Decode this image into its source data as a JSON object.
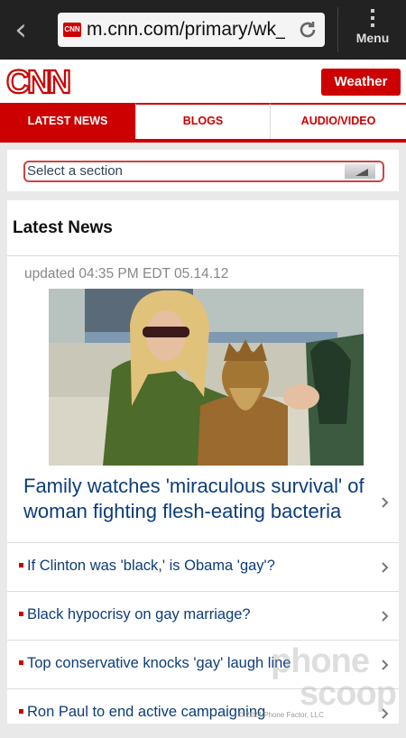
{
  "browser": {
    "url": "m.cnn.com/primary/wk_...",
    "favicon_text": "CNN",
    "menu_label": "Menu"
  },
  "header": {
    "logo_text": "CNN",
    "weather_label": "Weather"
  },
  "tabs": [
    {
      "label": "LATEST NEWS",
      "active": true
    },
    {
      "label": "BLOGS",
      "active": false
    },
    {
      "label": "AUDIO/VIDEO",
      "active": false
    }
  ],
  "section_select": {
    "value": "Select a section"
  },
  "main": {
    "title": "Latest News",
    "updated": "updated 04:35 PM EDT 05.14.12",
    "headline": "Family watches 'miraculous survival' of woman fighting flesh-eating bacteria",
    "items": [
      {
        "label": "If Clinton was 'black,' is Obama 'gay'?"
      },
      {
        "label": "Black hypocrisy on gay marriage?"
      },
      {
        "label": "Top conservative knocks 'gay' laugh line"
      },
      {
        "label": "Ron Paul to end active campaigning"
      }
    ]
  },
  "watermark": {
    "line1": "phone",
    "line2": "scoop",
    "copyright": "© 2024 Phone Factor, LLC"
  },
  "colors": {
    "brand": "#cc0000",
    "link": "#0c3d7a",
    "browser_bar": "#222222"
  }
}
